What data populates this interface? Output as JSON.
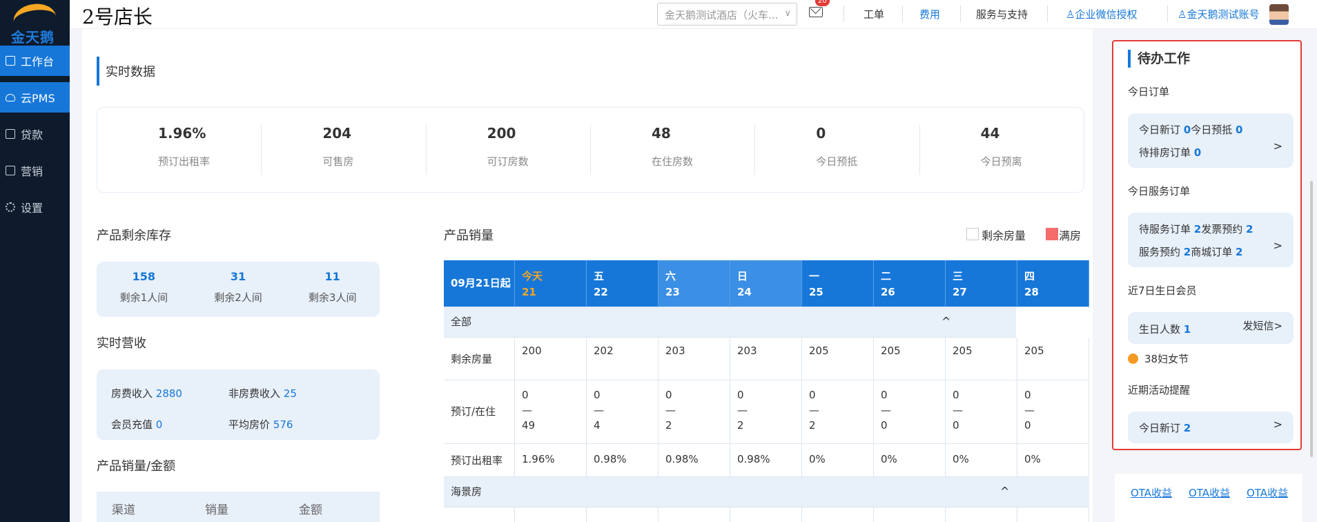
{
  "app": {
    "logo_text": "金天鹅",
    "brand": "2号店长"
  },
  "sidebar": {
    "items": [
      {
        "label": "工作台",
        "icon": "workbench-icon"
      },
      {
        "label": "云PMS",
        "icon": "cloud-icon"
      },
      {
        "label": "贷款",
        "icon": "loan-icon"
      },
      {
        "label": "营销",
        "icon": "marketing-icon"
      },
      {
        "label": "设置",
        "icon": "gear-icon"
      }
    ]
  },
  "topbar": {
    "hotel_select": "金天鹅测试酒店（火车...",
    "mail_badge": "20",
    "links": [
      "工单",
      "费用",
      "服务与支持",
      "企业微信授权",
      "金天鹅测试账号"
    ]
  },
  "realtime": {
    "title": "实时数据",
    "stats": [
      {
        "value": "1.96%",
        "label": "预订出租率"
      },
      {
        "value": "204",
        "label": "可售房"
      },
      {
        "value": "200",
        "label": "可订房数"
      },
      {
        "value": "48",
        "label": "在住房数"
      },
      {
        "value": "0",
        "label": "今日预抵"
      },
      {
        "value": "44",
        "label": "今日预离"
      }
    ]
  },
  "inventory": {
    "title": "产品剩余库存",
    "items": [
      {
        "value": "158",
        "label": "剩余1人间"
      },
      {
        "value": "31",
        "label": "剩余2人间"
      },
      {
        "value": "11",
        "label": "剩余3人间"
      }
    ]
  },
  "revenue": {
    "title": "实时营收",
    "room_label": "房费收入",
    "room_value": "2880",
    "nonroom_label": "非房费收入",
    "nonroom_value": "25",
    "member_label": "会员充值",
    "member_value": "0",
    "avg_label": "平均房价",
    "avg_value": "576"
  },
  "channel": {
    "title": "产品销量/金额",
    "cols": [
      "渠道",
      "销量",
      "金额"
    ]
  },
  "sales": {
    "title": "产品销量",
    "legend_remaining": "剩余房量",
    "legend_full": "满房",
    "legend_full_color": "#f56c6c",
    "start_label": "09月21日起",
    "days": [
      {
        "wd": "今天",
        "d": "21"
      },
      {
        "wd": "五",
        "d": "22"
      },
      {
        "wd": "六",
        "d": "23"
      },
      {
        "wd": "日",
        "d": "24"
      },
      {
        "wd": "一",
        "d": "25"
      },
      {
        "wd": "二",
        "d": "26"
      },
      {
        "wd": "三",
        "d": "27"
      },
      {
        "wd": "四",
        "d": "28"
      }
    ],
    "group_all": "全部",
    "group_sea": "海景房",
    "collapse_icon": "^",
    "rows": [
      {
        "label": "剩余房量",
        "values": [
          "200",
          "202",
          "203",
          "203",
          "205",
          "205",
          "205",
          "205"
        ]
      },
      {
        "label": "预订/在住",
        "top": [
          "0",
          "0",
          "0",
          "0",
          "0",
          "0",
          "0",
          "0"
        ],
        "dash": "—",
        "bottom": [
          "49",
          "4",
          "2",
          "2",
          "2",
          "0",
          "0",
          "0"
        ]
      },
      {
        "label": "预订出租率",
        "values": [
          "1.96%",
          "0.98%",
          "0.98%",
          "0.98%",
          "0%",
          "0%",
          "0%",
          "0%"
        ]
      }
    ]
  },
  "todo": {
    "title": "待办工作",
    "today_orders_title": "今日订单",
    "new_label": "今日新订",
    "new_value": "0",
    "arrive_label": "今日预抵",
    "arrive_value": "0",
    "assign_label": "待排房订单",
    "assign_value": "0",
    "service_title": "今日服务订单",
    "svc_pending_label": "待服务订单",
    "svc_pending_value": "2",
    "invoice_label": "发票预约",
    "invoice_value": "2",
    "svc_booking_label": "服务预约",
    "svc_booking_value": "2",
    "mall_label": "商城订单",
    "mall_value": "2",
    "birthday_title": "近7日生日会员",
    "birthday_label": "生日人数",
    "birthday_value": "1",
    "sms_link": "发短信>",
    "holiday": "38妇女节",
    "holiday_color": "#f59a23",
    "activity_title": "近期活动提醒",
    "activity_label": "今日新订",
    "activity_value": "2",
    "arrow": ">"
  },
  "ota": {
    "links": [
      "OTA收益",
      "OTA收益",
      "OTA收益"
    ]
  }
}
